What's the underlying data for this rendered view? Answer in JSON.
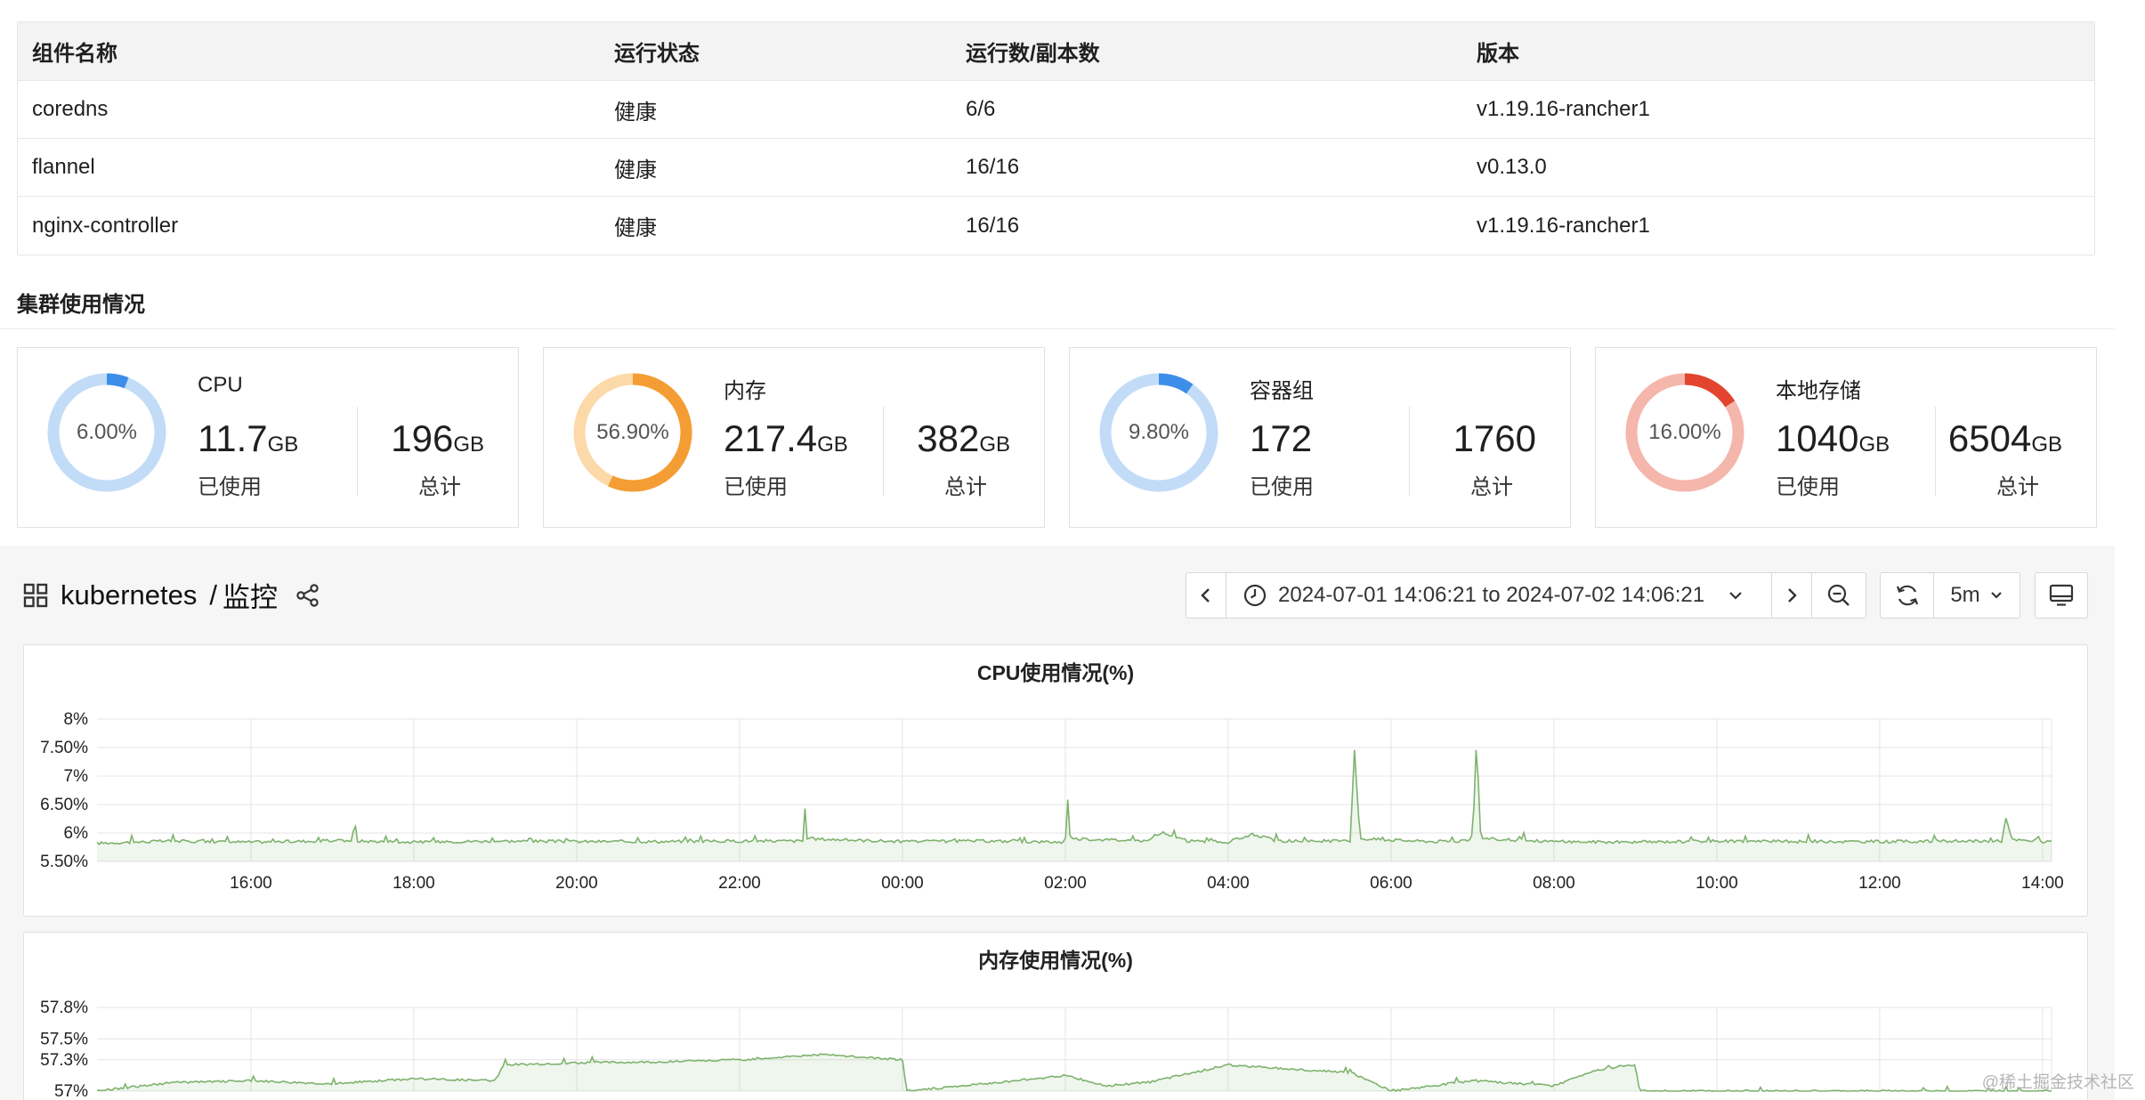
{
  "table": {
    "headers": [
      "组件名称",
      "运行状态",
      "运行数/副本数",
      "版本"
    ],
    "rows": [
      [
        "coredns",
        "健康",
        "6/6",
        "v1.19.16-rancher1"
      ],
      [
        "flannel",
        "健康",
        "16/16",
        "v0.13.0"
      ],
      [
        "nginx-controller",
        "健康",
        "16/16",
        "v1.19.16-rancher1"
      ]
    ]
  },
  "usage": {
    "title": "集群使用情况",
    "cards": [
      {
        "name": "CPU",
        "percent_label": "6.00%",
        "percent": 6.0,
        "used": "11.7",
        "used_unit": "GB",
        "used_caption": "已使用",
        "total": "196",
        "total_unit": "GB",
        "total_caption": "总计",
        "color": "#3d8ee8",
        "track": "#c2dcf8"
      },
      {
        "name": "内存",
        "percent_label": "56.90%",
        "percent": 56.9,
        "used": "217.4",
        "used_unit": "GB",
        "used_caption": "已使用",
        "total": "382",
        "total_unit": "GB",
        "total_caption": "总计",
        "color": "#f49d34",
        "track": "#fbd9a8"
      },
      {
        "name": "容器组",
        "percent_label": "9.80%",
        "percent": 9.8,
        "used": "172",
        "used_unit": "",
        "used_caption": "已使用",
        "total": "1760",
        "total_unit": "",
        "total_caption": "总计",
        "color": "#3d8ee8",
        "track": "#c2dcf8"
      },
      {
        "name": "本地存储",
        "percent_label": "16.00%",
        "percent": 16.0,
        "used": "1040",
        "used_unit": "GB",
        "used_caption": "已使用",
        "total": "6504",
        "total_unit": "GB",
        "total_caption": "总计",
        "color": "#e2442f",
        "track": "#f5b6ab"
      }
    ]
  },
  "dashboard": {
    "folder": "kubernetes",
    "separator": "/",
    "name": "监控",
    "time_range": "2024-07-01 14:06:21 to 2024-07-02 14:06:21",
    "refresh_interval": "5m",
    "icons": [
      "grid-icon",
      "share-icon",
      "chevron-left-icon",
      "clock-icon",
      "chevron-down-icon",
      "chevron-right-icon",
      "zoom-out-icon",
      "refresh-icon",
      "monitor-icon"
    ]
  },
  "chart_data": [
    {
      "type": "line",
      "title": "CPU使用情况(%)",
      "xlabel": "",
      "ylabel": "",
      "x_ticks": [
        "16:00",
        "18:00",
        "20:00",
        "22:00",
        "00:00",
        "02:00",
        "04:00",
        "06:00",
        "08:00",
        "10:00",
        "12:00",
        "14:00"
      ],
      "y_ticks": [
        "5.50%",
        "6%",
        "6.50%",
        "7%",
        "7.50%",
        "8%"
      ],
      "ylim": [
        5.5,
        8
      ],
      "grid": true,
      "color": "#7eb26d",
      "series": [
        {
          "baseline": 5.85,
          "points": [
            [
              14.11,
              5.82
            ],
            [
              15.0,
              5.86
            ],
            [
              16.0,
              5.84
            ],
            [
              17.25,
              5.87
            ],
            [
              17.27,
              6.3
            ],
            [
              17.3,
              5.86
            ],
            [
              18.0,
              5.84
            ],
            [
              19.0,
              5.86
            ],
            [
              20.0,
              5.85
            ],
            [
              21.0,
              5.85
            ],
            [
              22.0,
              5.86
            ],
            [
              22.78,
              5.86
            ],
            [
              22.8,
              6.5
            ],
            [
              22.83,
              5.9
            ],
            [
              24.0,
              5.85
            ],
            [
              25.0,
              5.86
            ],
            [
              26.0,
              5.84
            ],
            [
              26.03,
              6.6
            ],
            [
              26.06,
              5.9
            ],
            [
              27.0,
              5.86
            ],
            [
              27.2,
              6.0
            ],
            [
              27.5,
              5.86
            ],
            [
              28.0,
              5.84
            ],
            [
              28.3,
              5.98
            ],
            [
              28.6,
              5.86
            ],
            [
              29.5,
              5.86
            ],
            [
              29.55,
              7.45
            ],
            [
              29.62,
              5.9
            ],
            [
              30.5,
              5.85
            ],
            [
              31.0,
              5.86
            ],
            [
              31.05,
              7.7
            ],
            [
              31.1,
              5.9
            ],
            [
              32.0,
              5.85
            ],
            [
              33.0,
              5.84
            ],
            [
              34.0,
              5.86
            ],
            [
              35.0,
              5.85
            ],
            [
              36.0,
              5.85
            ],
            [
              37.5,
              5.86
            ],
            [
              37.55,
              6.28
            ],
            [
              37.62,
              5.88
            ],
            [
              38.1,
              5.84
            ]
          ]
        }
      ]
    },
    {
      "type": "line",
      "title": "内存使用情况(%)",
      "xlabel": "",
      "ylabel": "",
      "y_ticks": [
        "57%",
        "57.3%",
        "57.5%",
        "57.8%"
      ],
      "ylim": [
        57,
        57.8
      ],
      "grid": true,
      "color": "#7eb26d",
      "series": [
        {
          "points": [
            [
              14.11,
              57.0
            ],
            [
              15.0,
              57.08
            ],
            [
              16.0,
              57.1
            ],
            [
              17.0,
              57.07
            ],
            [
              18.0,
              57.12
            ],
            [
              19.0,
              57.1
            ],
            [
              19.1,
              57.25
            ],
            [
              20.0,
              57.27
            ],
            [
              21.0,
              57.28
            ],
            [
              22.0,
              57.3
            ],
            [
              23.0,
              57.35
            ],
            [
              24.0,
              57.3
            ],
            [
              24.05,
              57.0
            ],
            [
              25.0,
              57.07
            ],
            [
              26.0,
              57.15
            ],
            [
              26.5,
              57.05
            ],
            [
              27.0,
              57.08
            ],
            [
              28.0,
              57.25
            ],
            [
              29.0,
              57.2
            ],
            [
              29.5,
              57.18
            ],
            [
              30.0,
              57.0
            ],
            [
              31.0,
              57.1
            ],
            [
              32.0,
              57.05
            ],
            [
              32.5,
              57.2
            ],
            [
              33.0,
              57.25
            ],
            [
              33.05,
              57.0
            ],
            [
              34.0,
              57.0
            ]
          ]
        }
      ]
    }
  ],
  "watermark": "@稀土掘金技术社区"
}
